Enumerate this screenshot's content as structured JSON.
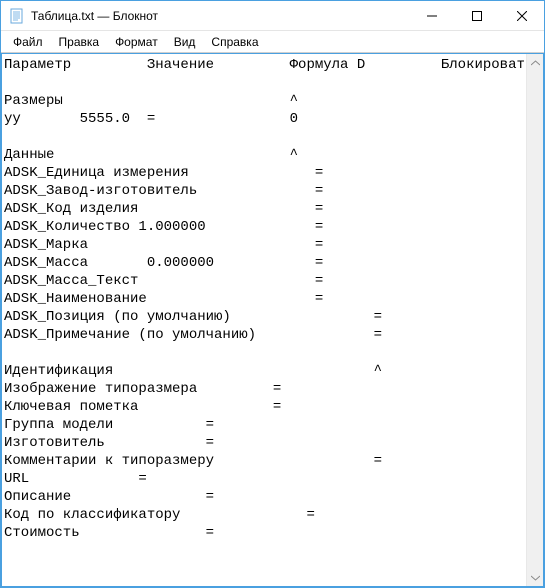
{
  "titlebar": {
    "title": "Таблица.txt — Блокнот"
  },
  "menubar": {
    "file": "Файл",
    "edit": "Правка",
    "format": "Формат",
    "view": "Вид",
    "help": "Справка"
  },
  "columns": {
    "param": "Параметр",
    "value": "Значение",
    "formula": "Формула",
    "d": "D",
    "lock": "Блокировать"
  },
  "sections": {
    "sizes": {
      "label": "Размеры",
      "mark": "^",
      "rows": [
        {
          "name": "уу",
          "value": "5555.0",
          "eq": "=",
          "extra": "0"
        }
      ]
    },
    "data": {
      "label": "Данные",
      "mark": "^",
      "rows": [
        {
          "text": "ADSK_Единица измерения",
          "eq": "="
        },
        {
          "text": "ADSK_Завод-изготовитель",
          "eq": "="
        },
        {
          "text": "ADSK_Код изделия",
          "eq": "="
        },
        {
          "text": "ADSK_Количество 1.000000",
          "eq": "="
        },
        {
          "text": "ADSK_Марка",
          "eq": "="
        },
        {
          "text": "ADSK_Масса       0.000000",
          "eq": "="
        },
        {
          "text": "ADSK_Масса_Текст",
          "eq": "="
        },
        {
          "text": "ADSK_Наименование",
          "eq": "="
        },
        {
          "text": "ADSK_Позиция (по умолчанию)",
          "eq": "="
        },
        {
          "text": "ADSK_Примечание (по умолчанию)",
          "eq": "="
        }
      ]
    },
    "ident": {
      "label": "Идентификация",
      "mark": "^",
      "rows": [
        {
          "text": "Изображение типоразмера",
          "eq": "="
        },
        {
          "text": "Ключевая пометка",
          "eq": "="
        },
        {
          "text": "Группа модели",
          "eq": "="
        },
        {
          "text": "Изготовитель",
          "eq": "="
        },
        {
          "text": "Комментарии к типоразмеру",
          "eq": "="
        },
        {
          "text": "URL",
          "eq": "="
        },
        {
          "text": "Описание",
          "eq": "="
        },
        {
          "text": "Код по классификатору",
          "eq": "="
        },
        {
          "text": "Стоимость",
          "eq": "="
        }
      ]
    }
  }
}
